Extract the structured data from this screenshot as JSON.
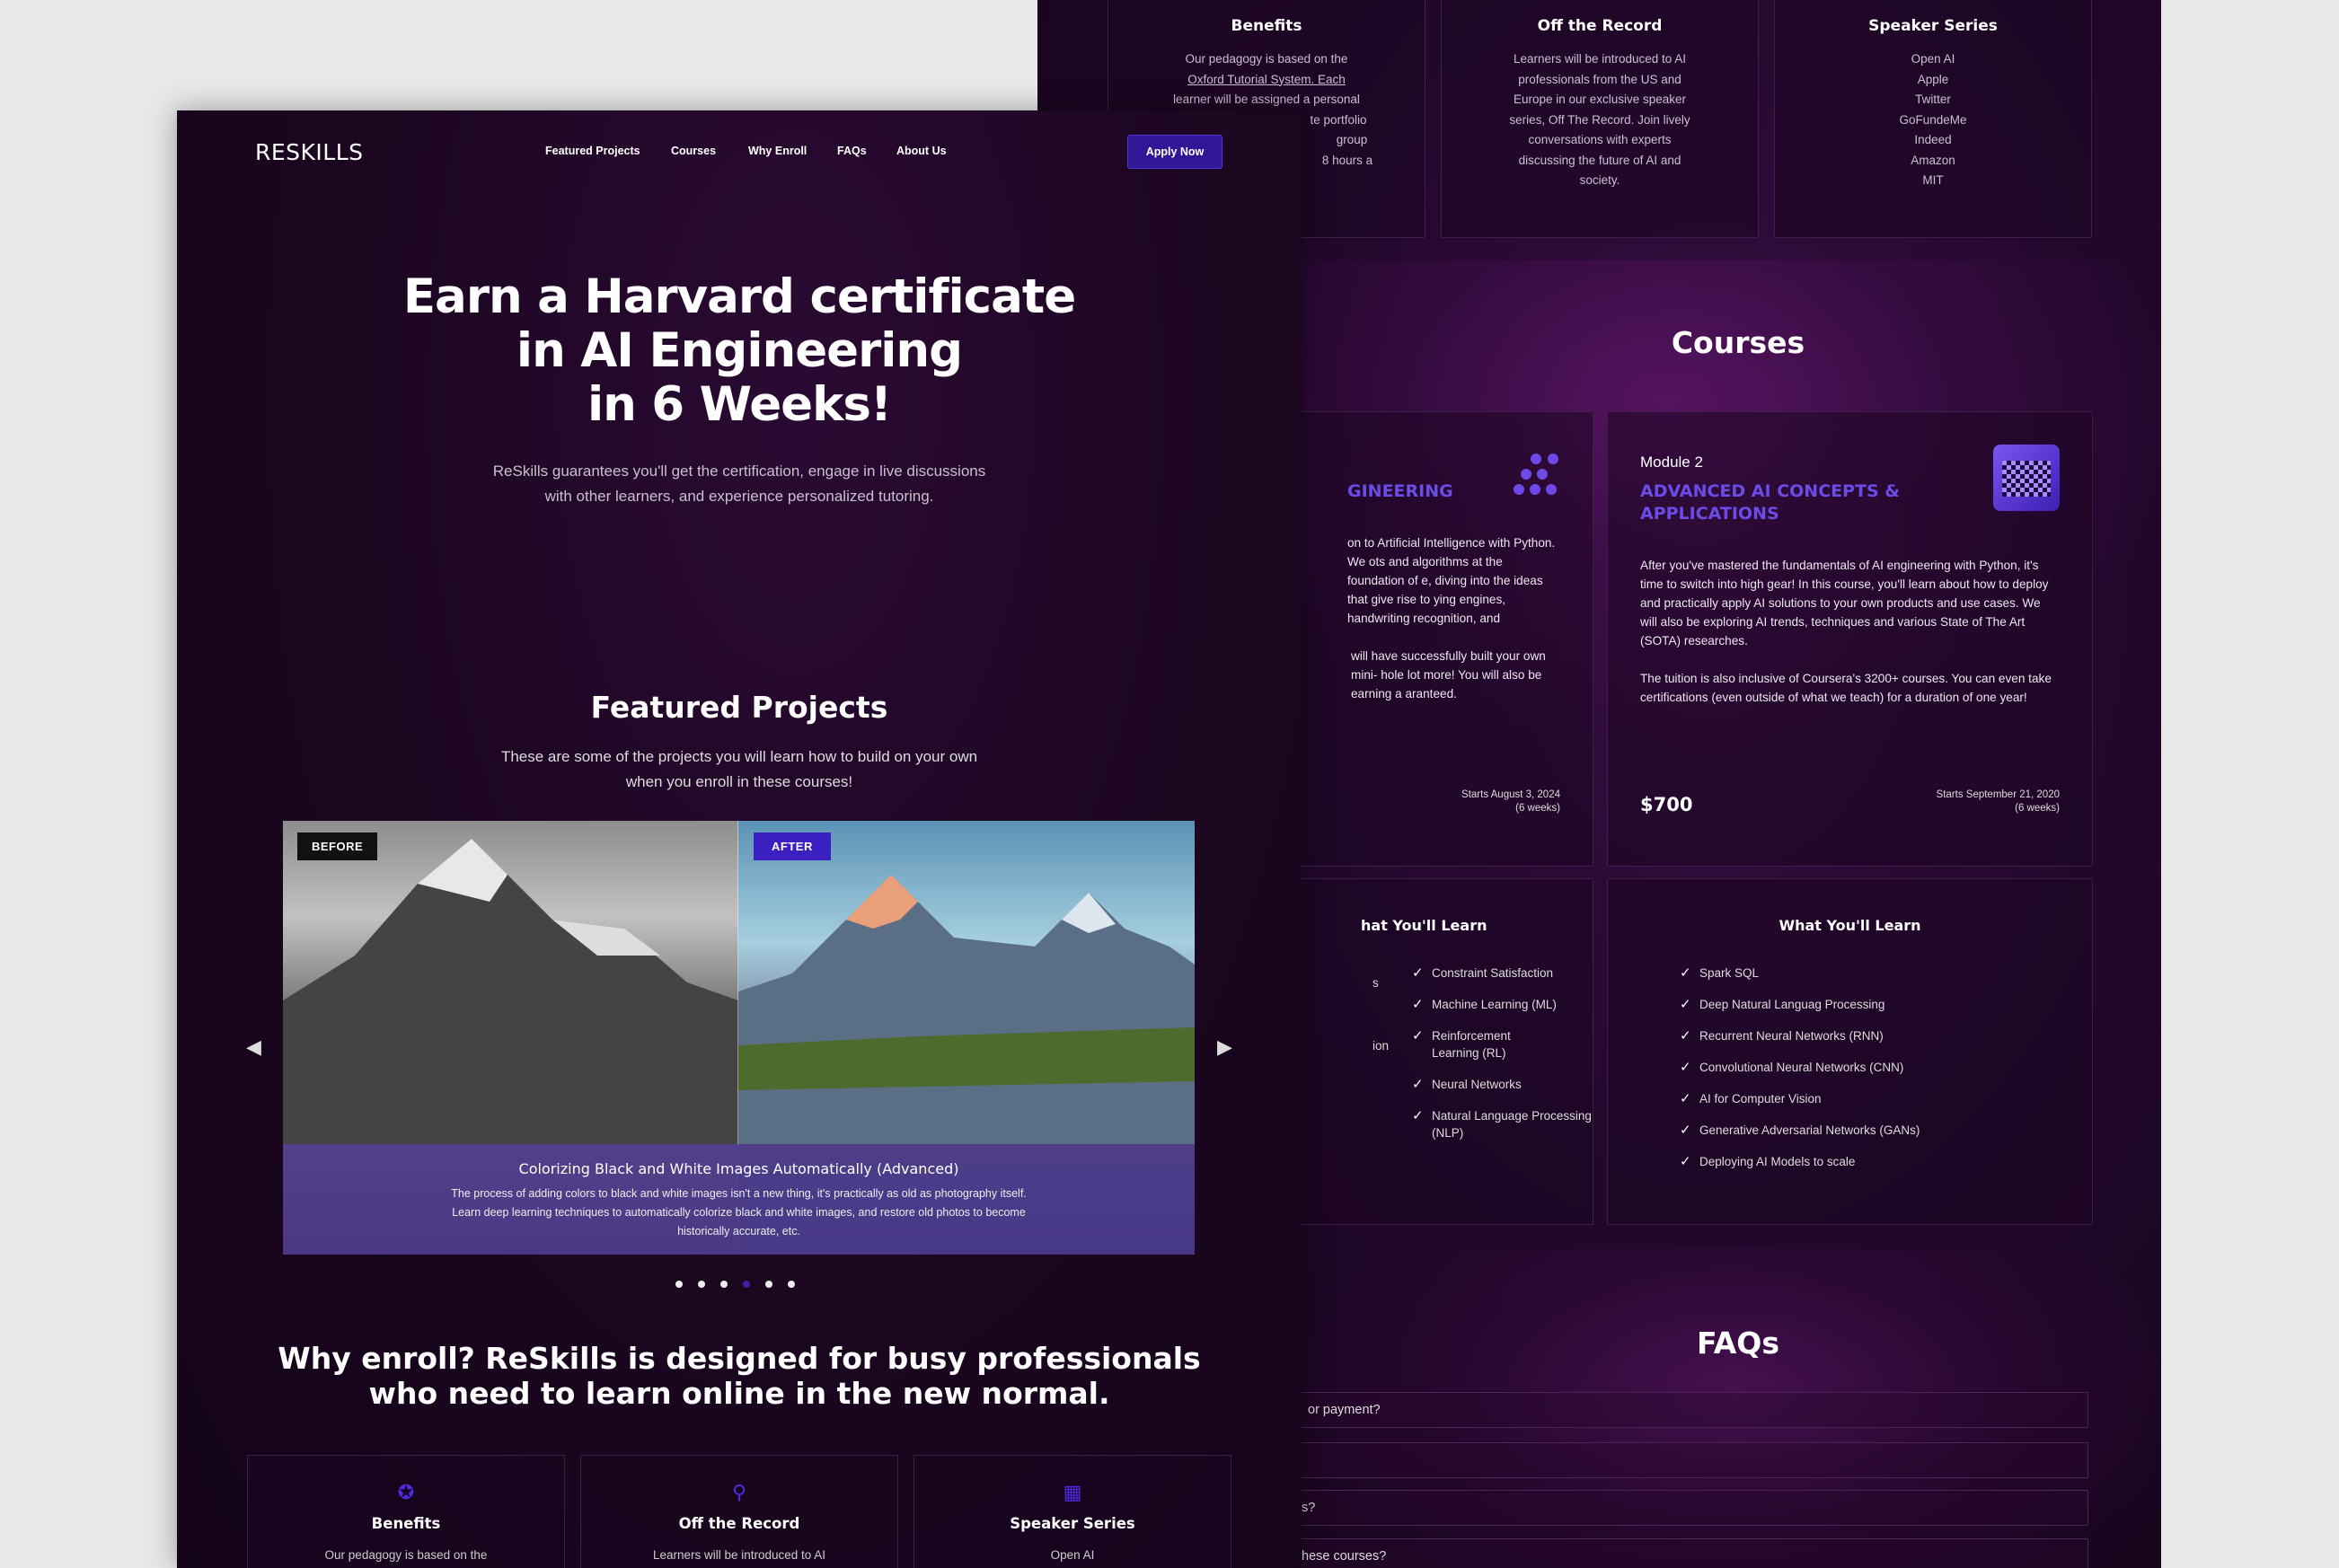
{
  "back": {
    "top_cards": [
      {
        "title": "Benefits",
        "lines": [
          "Our pedagogy is based on the",
          "Oxford Tutorial System. Each",
          "learner will be assigned a personal",
          "te portfolio",
          "group",
          "8 hours a"
        ]
      },
      {
        "title": "Off the Record",
        "lines": [
          "Learners will be introduced to AI",
          "professionals from the US and",
          "Europe in our exclusive speaker",
          "series, Off The Record. Join lively",
          "conversations with experts",
          "discussing the future of AI and",
          "society."
        ]
      },
      {
        "title": "Speaker Series",
        "lines": [
          "Open AI",
          "Apple",
          "Twitter",
          "GoFundeMe",
          "Indeed",
          "Amazon",
          "MIT"
        ]
      }
    ],
    "courses_title": "Courses",
    "course1": {
      "title": "GINEERING",
      "desc": "on to Artificial Intelligence with Python. We ots and algorithms at the foundation of e, diving into the ideas that give rise to ying engines, handwriting recognition, and",
      "desc2": "will have successfully built your own mini- hole lot more! You will also be earning a aranteed.",
      "starts": "Starts August 3, 2024",
      "duration": "(6 weeks)"
    },
    "course2": {
      "module": "Module 2",
      "title": "ADVANCED AI CONCEPTS & APPLICATIONS",
      "desc": "After you've mastered the fundamentals of AI engineering with Python, it's time to switch into high gear! In this course, you'll learn about how to deploy and practically apply AI solutions to your own products and use cases. We will also be exploring AI trends, techniques and various State of The Art (SOTA) researches.",
      "desc2": "The tuition is also inclusive of Coursera's 3200+ courses. You can even take certifications (even outside of what we teach) for a duration of one year!",
      "price": "$700",
      "starts": "Starts September 21, 2020",
      "duration": "(6 weeks)"
    },
    "learn1": {
      "title": "hat You'll Learn",
      "items": [
        "Constraint Satisfaction",
        "Machine Learning (ML)",
        "Reinforcement Learning (RL)",
        "Neural Networks",
        "Natural Language Processing (NLP)"
      ],
      "left_fragments": [
        "s",
        "ion"
      ]
    },
    "learn2": {
      "title": "What You'll Learn",
      "items": [
        "Spark SQL",
        "Deep Natural Languag Processing",
        "Recurrent Neural Networks (RNN)",
        "Convolutional Neural Networks (CNN)",
        "AI for Computer Vision",
        "Generative Adversarial Networks (GANs)",
        "Deploying AI Models to scale"
      ]
    },
    "faqs_title": "FAQs",
    "faqs": [
      "or payment?",
      "",
      "s?",
      "hese courses?"
    ]
  },
  "front": {
    "logo": "RESKILLS",
    "nav": [
      "Featured Projects",
      "Courses",
      "Why Enroll",
      "FAQs",
      "About Us"
    ],
    "apply": "Apply Now",
    "hero_lines": [
      "Earn a Harvard certificate",
      "in AI Engineering",
      "in 6 Weeks!"
    ],
    "hero_sub_lines": [
      "ReSkills guarantees you'll get the certification, engage in live discussions",
      "with other learners, and experience personalized tutoring."
    ],
    "fp_title": "Featured Projects",
    "fp_sub_lines": [
      "These are some of the projects you will learn how to build on your own",
      "when you enroll in these courses!"
    ],
    "slide": {
      "before": "BEFORE",
      "after": "AFTER",
      "title": "Colorizing Black and White Images Automatically (Advanced)",
      "desc": "The process of adding colors to black and white images isn't a new thing, it's practically as old as photography itself. Learn deep learning techniques to automatically colorize black and white images, and restore old photos to become historically accurate, etc.",
      "active_index": 3,
      "count": 6
    },
    "why_lines": [
      "Why enroll? ReSkills is designed for busy professionals",
      "who need to learn online in the new normal."
    ],
    "cards": [
      {
        "title": "Benefits",
        "text": "Our pedagogy is based on the",
        "icon": "star-icon"
      },
      {
        "title": "Off the Record",
        "text": "Learners will be introduced to AI",
        "icon": "mic-off-icon"
      },
      {
        "title": "Speaker Series",
        "text": "Open AI",
        "icon": "chat-icon"
      }
    ],
    "accent": "#2f1797"
  }
}
